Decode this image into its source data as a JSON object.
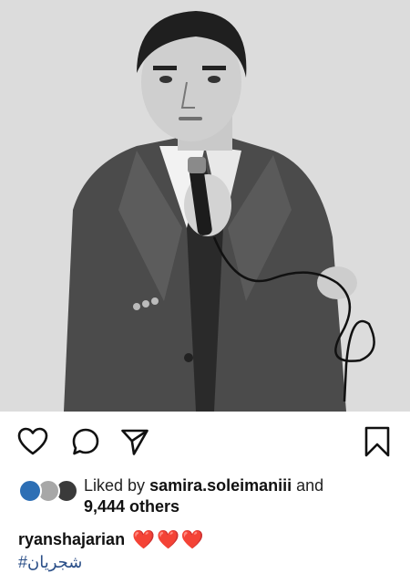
{
  "post": {
    "image_alt": "",
    "likes": {
      "prefix": "Liked by",
      "liker": "samira.soleimaniii",
      "connector": "and",
      "others": "9,444 others"
    },
    "caption": {
      "username": "ryanshajarian",
      "hearts": "❤️❤️❤️"
    },
    "hashtag": "#شجریان"
  },
  "icons": {
    "like": "heart-outline-icon",
    "comment": "comment-bubble-icon",
    "share": "paper-plane-icon",
    "save": "bookmark-icon"
  },
  "colors": {
    "hashtag": "#2b4f88",
    "heart": "#e0153a",
    "text": "#111111"
  }
}
